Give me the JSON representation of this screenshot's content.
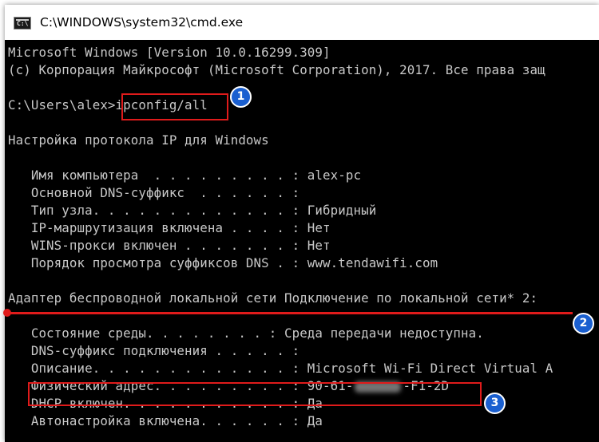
{
  "window": {
    "title": "C:\\WINDOWS\\system32\\cmd.exe",
    "icon_glyph": "C:\\"
  },
  "console": {
    "lines": [
      "Microsoft Windows [Version 10.0.16299.309]",
      "(c) Корпорация Майкрософт (Microsoft Corporation), 2017. Все права защ",
      "",
      "C:\\Users\\alex>ipconfig/all",
      "",
      "Настройка протокола IP для Windows",
      "",
      "   Имя компьютера  . . . . . . . . . : alex-pc",
      "   Основной DNS-суффикс  . . . . . . :",
      "   Тип узла. . . . . . . . . . . . . : Гибридный",
      "   IP-маршрутизация включена . . . . : Нет",
      "   WINS-прокси включен . . . . . . . : Нет",
      "   Порядок просмотра суффиксов DNS . : www.tendawifi.com",
      "",
      "Адаптер беспроводной локальной сети Подключение по локальной сети* 2:",
      "",
      "   Состояние среды. . . . . . . . : Среда передачи недоступна.",
      "   DNS-суффикс подключения . . . . . :",
      "   Описание. . . . . . . . . . . . . : Microsoft Wi-Fi Direct Virtual A",
      "   Физический адрес. . . . . . . . . : 90-61-",
      "   DHCP включен. . . . . . . . . . . : Да",
      "   Автонастройка включена. . . . . . : Да"
    ],
    "mac_suffix": "-F1-2D"
  },
  "annotations": {
    "badge_1": "1",
    "badge_2": "2",
    "badge_3": "3",
    "accent_color": "#e01b1b",
    "badge_color": "#1a5fd0"
  }
}
